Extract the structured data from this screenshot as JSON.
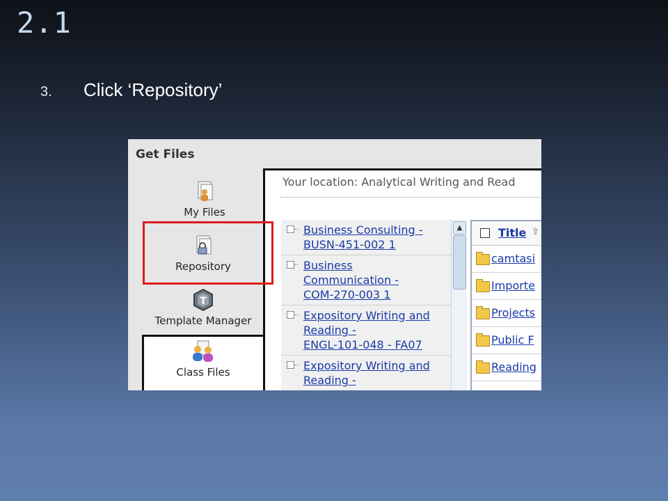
{
  "slide": {
    "title": "2.1",
    "step_number": "3.",
    "step_text": "Click ‘Repository’"
  },
  "app": {
    "panel_title": "Get Files",
    "nav": [
      {
        "label": "My Files",
        "icon": "my-files-icon"
      },
      {
        "label": "Repository",
        "icon": "repository-lock-icon"
      },
      {
        "label": "Template Manager",
        "icon": "template-manager-icon"
      },
      {
        "label": "Class Files",
        "icon": "class-files-icon"
      }
    ],
    "location": "Your location: Analytical Writing and Read",
    "courses": [
      {
        "lines": [
          "Business Consulting -",
          "BUSN-451-002 1"
        ]
      },
      {
        "lines": [
          "Business",
          "Communication -",
          "COM-270-003 1"
        ]
      },
      {
        "lines": [
          "Expository Writing and",
          "Reading -",
          "ENGL-101-048 - FA07"
        ]
      },
      {
        "lines": [
          "Expository Writing and",
          "Reading -"
        ]
      }
    ],
    "file_header": "Title",
    "files": [
      "camtasi",
      "Importe",
      "Projects",
      "Public F",
      "Reading"
    ],
    "colors": {
      "highlight": "#e01a1a",
      "link": "#1a3aa8"
    }
  }
}
